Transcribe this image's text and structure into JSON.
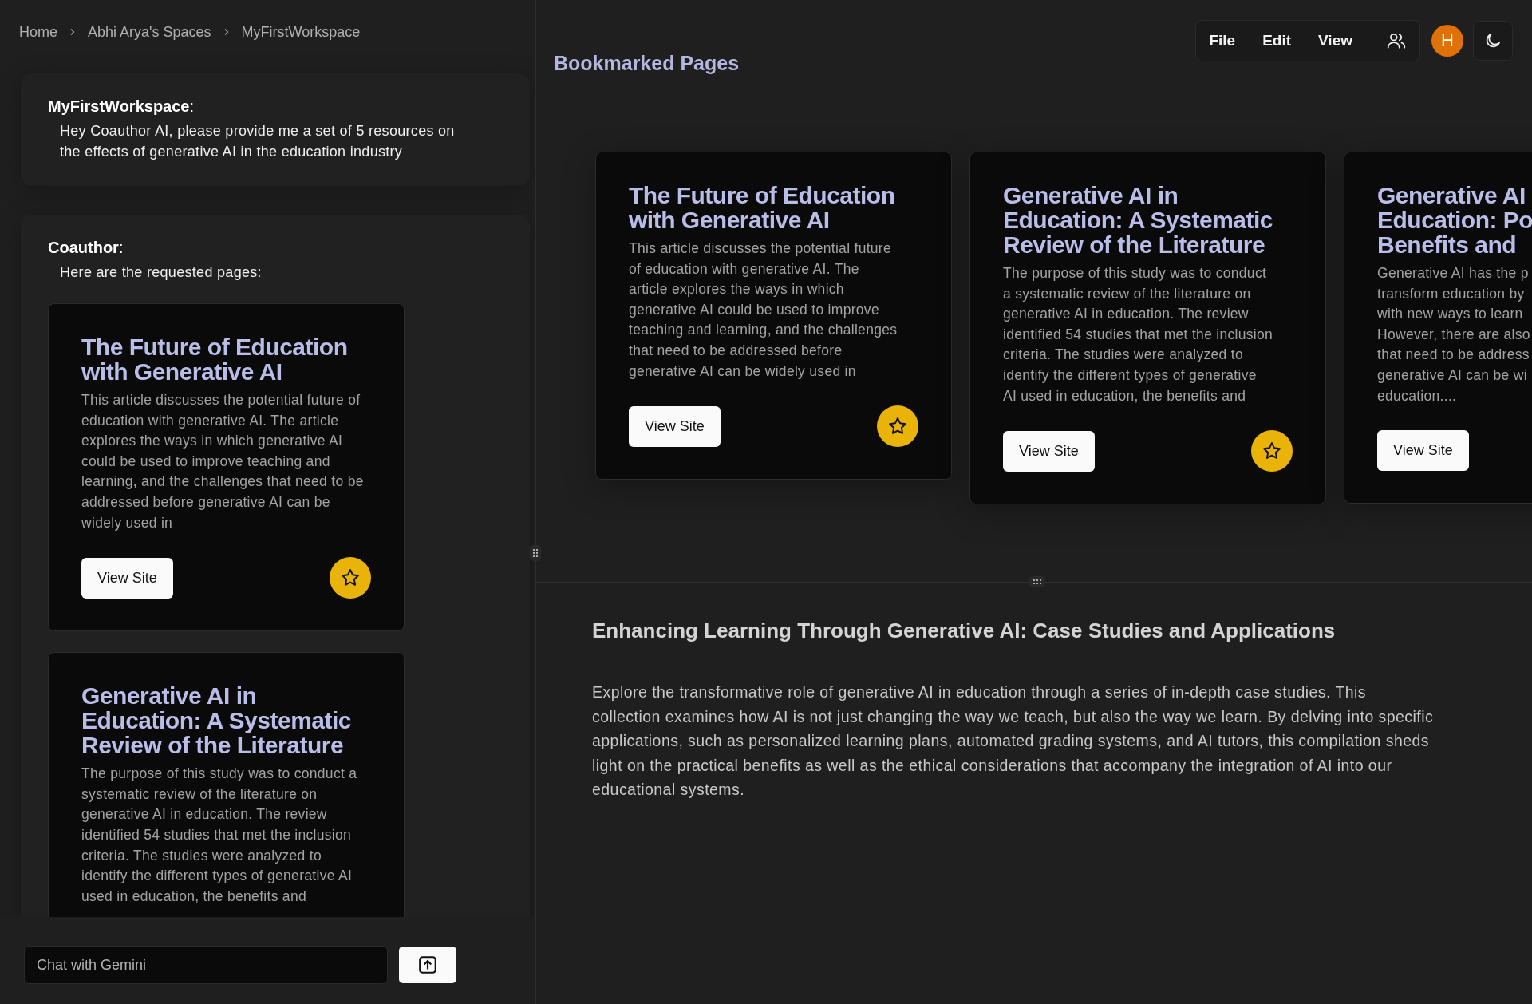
{
  "breadcrumb": [
    "Home",
    "Abhi Arya's Spaces",
    "MyFirstWorkspace"
  ],
  "chat": [
    {
      "author": "**MyFirstWorkspace**:",
      "text": "Hey Coauthor AI, please provide me a set of 5 resources on the effects of generative AI in the education industry"
    },
    {
      "author": "**Coauthor**:",
      "text": "Here are the requested pages:",
      "cards": [
        {
          "title": "The Future of Education with Generative AI",
          "description": "This article discusses the potential future of education with generative AI. The article explores the ways in which generative AI could be used to improve teaching and learning, and the challenges that need to be addressed before generative AI can be widely used in",
          "button": "View Site",
          "bookmarked": true
        },
        {
          "title": "Generative AI in Education: A Systematic Review of the Literature",
          "description": "The purpose of this study was to conduct a systematic review of the literature on generative AI in education. The review identified 54 studies that met the inclusion criteria. The studies were analyzed to identify the different types of generative AI used in education, the benefits and"
        }
      ]
    }
  ],
  "chat_input": {
    "placeholder": "Chat with Gemini"
  },
  "menu": [
    "File",
    "Edit",
    "View"
  ],
  "avatar": "H",
  "bookmarks": {
    "title": "Bookmarked Pages",
    "cards": [
      {
        "title": [
          "The Future of Education",
          "with Generative AI"
        ],
        "description": [
          "This article discusses the potential future",
          "of education with generative AI. The",
          "article explores the ways in which",
          "generative AI could be used to improve",
          "teaching and learning, and the challenges",
          "that need to be addressed before",
          "generative AI can be widely used in"
        ],
        "button": "View Site",
        "bookmarked": true
      },
      {
        "title": [
          "Generative AI in",
          "Education: A Systematic",
          "Review of the Literature"
        ],
        "description": [
          "The purpose of this study was to conduct",
          "a systematic review of the literature on",
          "generative AI in education. The review",
          "identified 54 studies that met the inclusion",
          "criteria. The studies were analyzed to",
          "identify the different types of generative",
          "AI used in education, the benefits and"
        ],
        "button": "View Site",
        "bookmarked": true
      },
      {
        "title": [
          "Generative AI",
          "Education: Po",
          "Benefits and"
        ],
        "description": [
          "Generative AI has the p",
          "transform education by",
          "with new ways to learn",
          "However, there are also",
          "that need to be address",
          "generative AI can be wi",
          "education...."
        ],
        "button": "View Site"
      }
    ]
  },
  "document": {
    "title": "Enhancing Learning Through Generative AI: Case Studies and Applications",
    "body": "Explore the transformative role of generative AI in education through a series of in-depth case studies. This collection examines how AI is not just changing the way we teach, but also the way we learn. By delving into specific applications, such as personalized learning plans, automated grading systems, and AI tutors, this compilation sheds light on the practical benefits as well as the ethical considerations that accompany the integration of AI into our educational systems."
  }
}
